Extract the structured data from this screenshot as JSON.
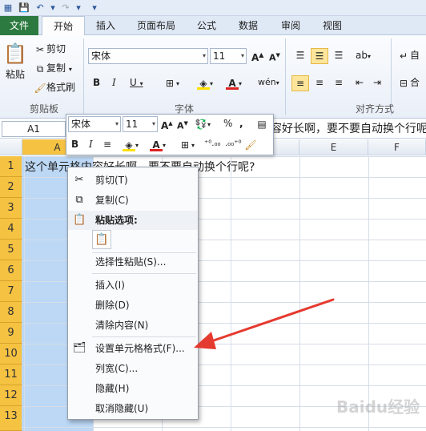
{
  "tabs": {
    "file": "文件",
    "home": "开始",
    "insert": "插入",
    "page_layout": "页面布局",
    "formulas": "公式",
    "data": "数据",
    "review": "审阅",
    "view": "视图"
  },
  "ribbon": {
    "paste": "粘贴",
    "cut": "剪切",
    "copy": "复制",
    "format_painter": "格式刷",
    "clipboard_group": "剪贴板",
    "font_name": "宋体",
    "font_size": "11",
    "font_group": "字体",
    "align_group": "对齐方式",
    "auto_partial": "自",
    "merge_partial": "合"
  },
  "formula_bar": {
    "name_box": "A1",
    "content_visible": "容好长啊，要不要自动换个行呢"
  },
  "columns": [
    "A",
    "D",
    "E",
    "F"
  ],
  "rows": [
    "1",
    "2",
    "3",
    "4",
    "5",
    "6",
    "7",
    "8",
    "9",
    "10",
    "11",
    "12",
    "13"
  ],
  "cell_a1": "这个单元格内容好长啊，要不要自动换个行呢?",
  "mini_toolbar": {
    "font_name": "宋体",
    "font_size": "11",
    "percent": "%",
    "comma": ","
  },
  "context_menu": {
    "cut": "剪切(T)",
    "copy": "复制(C)",
    "paste_options": "粘贴选项:",
    "paste_special": "选择性粘贴(S)...",
    "insert": "插入(I)",
    "delete": "删除(D)",
    "clear_contents": "清除内容(N)",
    "format_cells": "设置单元格格式(F)...",
    "column_width": "列宽(C)...",
    "hide": "隐藏(H)",
    "unhide": "取消隐藏(U)"
  },
  "watermark": "Baidu经验",
  "colors": {
    "file_tab": "#2c7a3f",
    "row_header_selected": "#f5c242",
    "column_selected": "#bcd8f5",
    "arrow": "#e53a2f"
  }
}
